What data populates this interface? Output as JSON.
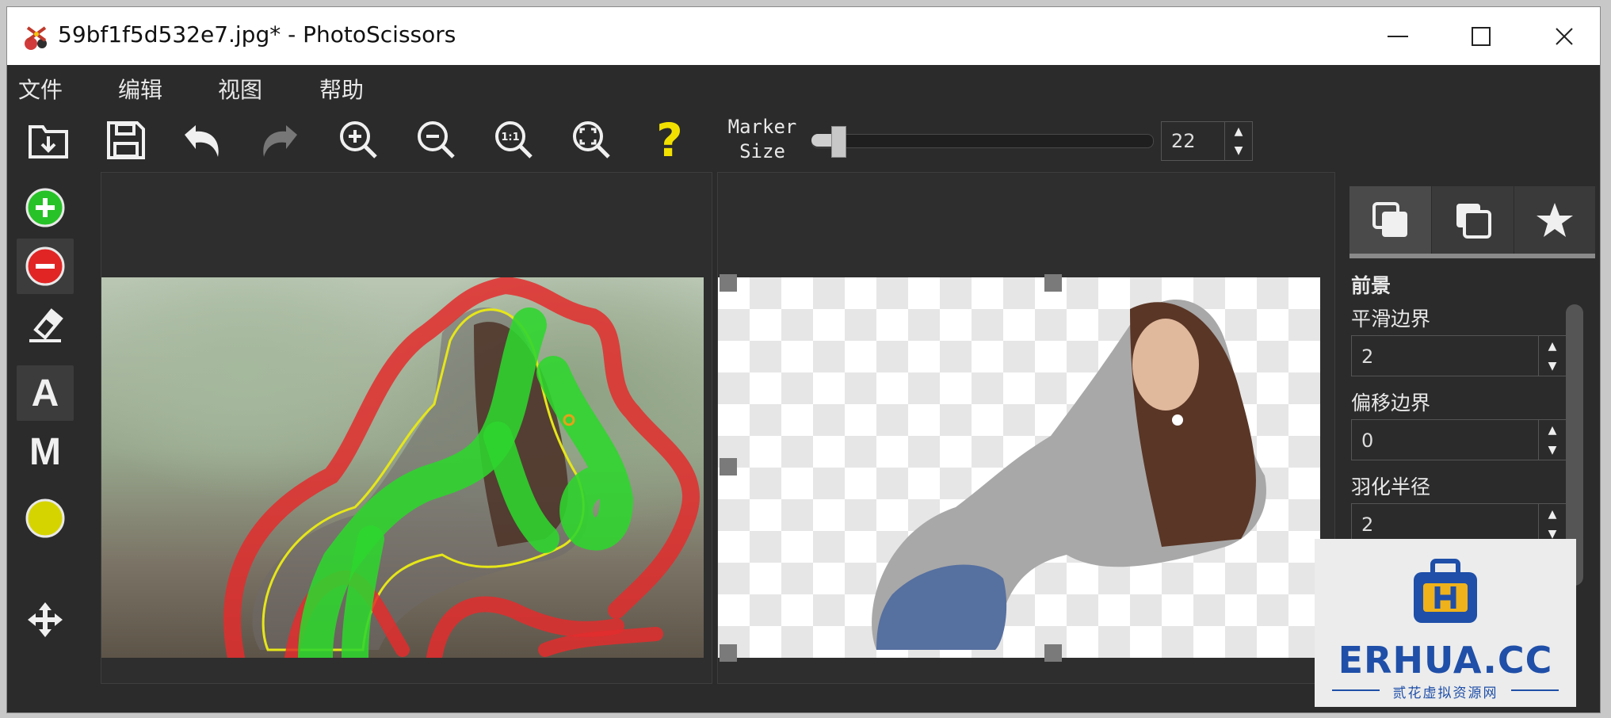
{
  "window": {
    "title": "59bf1f5d532e7.jpg* - PhotoScissors",
    "minimize_icon": "minimize-icon",
    "maximize_icon": "maximize-icon",
    "close_icon": "close-icon"
  },
  "menu": {
    "items": [
      {
        "label": "文件"
      },
      {
        "label": "编辑"
      },
      {
        "label": "视图"
      },
      {
        "label": "帮助"
      }
    ]
  },
  "toolbar": {
    "buttons": [
      {
        "icon": "open-icon"
      },
      {
        "icon": "save-icon"
      },
      {
        "icon": "undo-icon"
      },
      {
        "icon": "redo-icon"
      },
      {
        "icon": "zoom-in-icon"
      },
      {
        "icon": "zoom-out-icon"
      },
      {
        "icon": "actual-size-icon",
        "text": "1:1"
      },
      {
        "icon": "fit-screen-icon"
      },
      {
        "icon": "help-icon",
        "text": "?"
      }
    ],
    "marker_label_line1": "Marker",
    "marker_label_line2": "Size",
    "marker_size_value": "22",
    "spin_up": "▲",
    "spin_down": "▼"
  },
  "left_tools": {
    "items": [
      {
        "icon": "foreground-marker-icon"
      },
      {
        "icon": "background-marker-icon"
      },
      {
        "icon": "eraser-icon"
      },
      {
        "icon": "auto-mode-icon",
        "text": "A"
      },
      {
        "icon": "manual-mode-icon",
        "text": "M"
      },
      {
        "icon": "marker-color-icon"
      },
      {
        "icon": "move-icon"
      }
    ]
  },
  "right_panel": {
    "tabs": [
      {
        "icon": "foreground-tab-icon"
      },
      {
        "icon": "background-tab-icon"
      },
      {
        "icon": "effects-tab-icon"
      }
    ],
    "section_title": "前景",
    "smooth_label": "平滑边界",
    "smooth_value": "2",
    "offset_label": "偏移边界",
    "offset_value": "0",
    "feather_label": "羽化半径",
    "feather_value": "2"
  },
  "watermark": {
    "brand": "ERHUA.CC",
    "sub": "贰花虚拟资源网"
  },
  "colors": {
    "add_green": "#27c227",
    "remove_red": "#e12525",
    "marker_yellow": "#d6d400",
    "help_yellow": "#f2e100"
  }
}
